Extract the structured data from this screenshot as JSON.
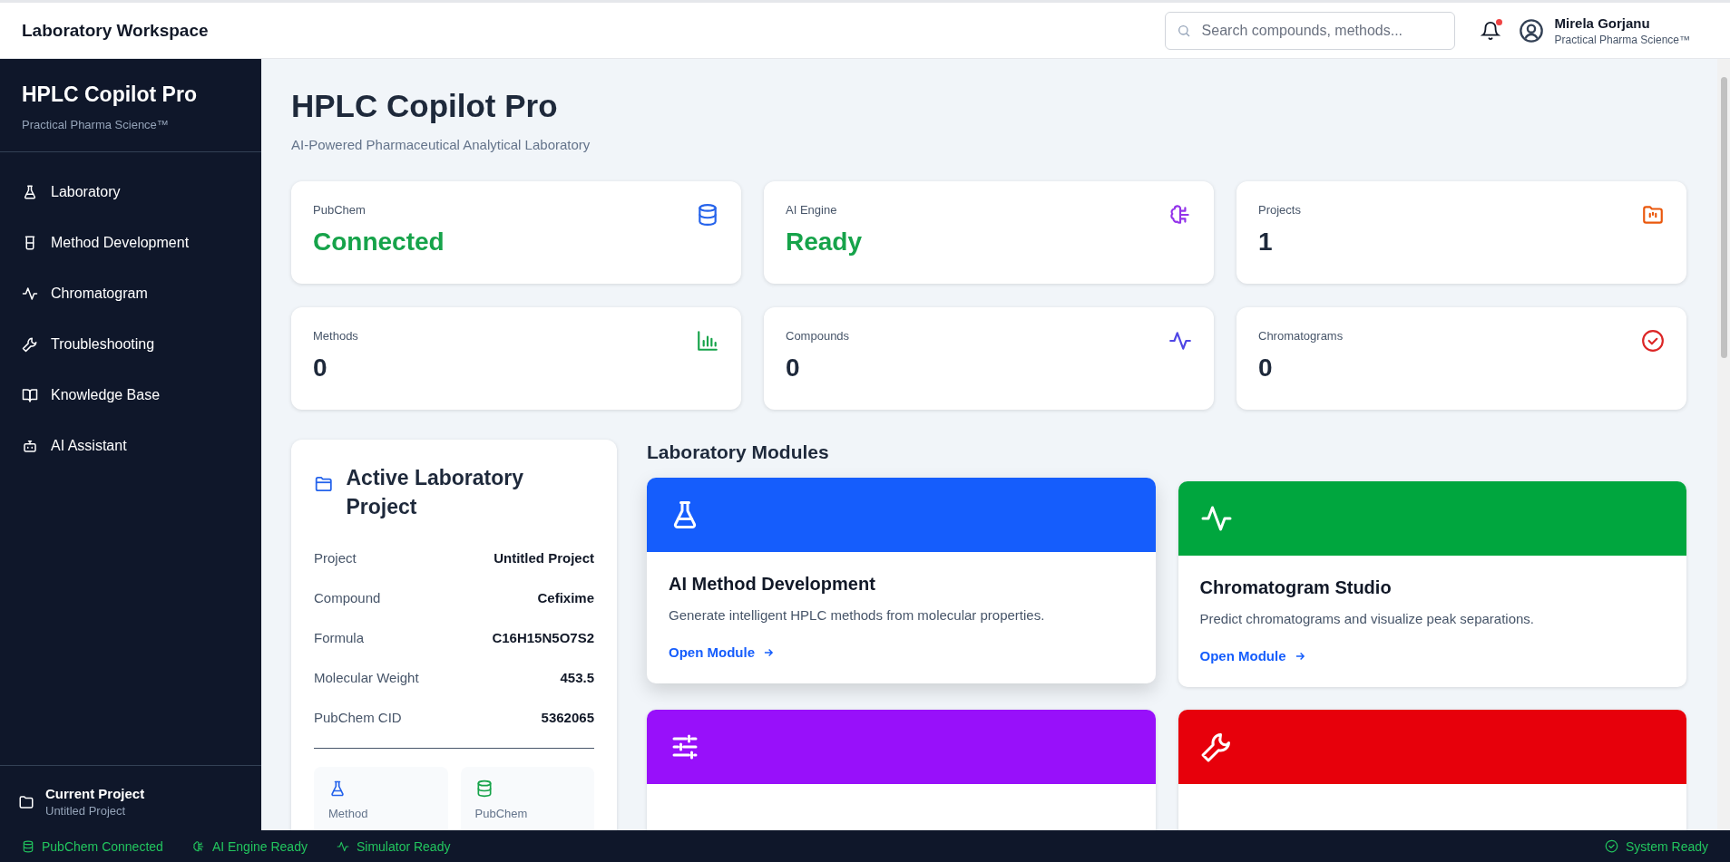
{
  "topbar": {
    "title": "Laboratory Workspace",
    "search": {
      "placeholder": "Search compounds, methods..."
    },
    "notifications": {
      "unread": true
    },
    "user": {
      "name": "Mirela Gorjanu",
      "org": "Practical Pharma Science™"
    }
  },
  "sidebar": {
    "title": "HPLC Copilot Pro",
    "subtitle": "Practical Pharma Science™",
    "items": [
      {
        "label": "Laboratory"
      },
      {
        "label": "Method Development"
      },
      {
        "label": "Chromatogram"
      },
      {
        "label": "Troubleshooting"
      },
      {
        "label": "Knowledge Base"
      },
      {
        "label": "AI Assistant"
      }
    ],
    "current_project": {
      "title": "Current Project",
      "name": "Untitled Project"
    }
  },
  "page": {
    "title": "HPLC Copilot Pro",
    "subtitle": "AI-Powered Pharmaceutical Analytical Laboratory"
  },
  "stats": [
    {
      "label": "PubChem",
      "value": "Connected",
      "kind": "status"
    },
    {
      "label": "AI Engine",
      "value": "Ready",
      "kind": "status"
    },
    {
      "label": "Projects",
      "value": "1",
      "kind": "count"
    },
    {
      "label": "Methods",
      "value": "0",
      "kind": "count"
    },
    {
      "label": "Compounds",
      "value": "0",
      "kind": "count"
    },
    {
      "label": "Chromatograms",
      "value": "0",
      "kind": "count"
    }
  ],
  "project": {
    "title": "Active Laboratory Project",
    "rows": [
      {
        "label": "Project",
        "value": "Untitled Project"
      },
      {
        "label": "Compound",
        "value": "Cefixime"
      },
      {
        "label": "Formula",
        "value": "C16H15N5O7S2"
      },
      {
        "label": "Molecular Weight",
        "value": "453.5"
      },
      {
        "label": "PubChem CID",
        "value": "5362065"
      }
    ],
    "tiles": [
      {
        "label": "Method"
      },
      {
        "label": "PubChem"
      }
    ]
  },
  "modules": {
    "title": "Laboratory Modules",
    "cards": [
      {
        "title": "AI Method Development",
        "description": "Generate intelligent HPLC methods from molecular properties.",
        "link": "Open Module",
        "color": "#155dfc"
      },
      {
        "title": "Chromatogram Studio",
        "description": "Predict chromatograms and visualize peak separations.",
        "link": "Open Module",
        "color": "#00a63e"
      },
      {
        "color": "#9810fa"
      },
      {
        "color": "#e7000b"
      }
    ]
  },
  "status_bar": {
    "items": [
      {
        "label": "PubChem Connected"
      },
      {
        "label": "AI Engine Ready"
      },
      {
        "label": "Simulator Ready"
      }
    ],
    "system": "System Ready"
  }
}
